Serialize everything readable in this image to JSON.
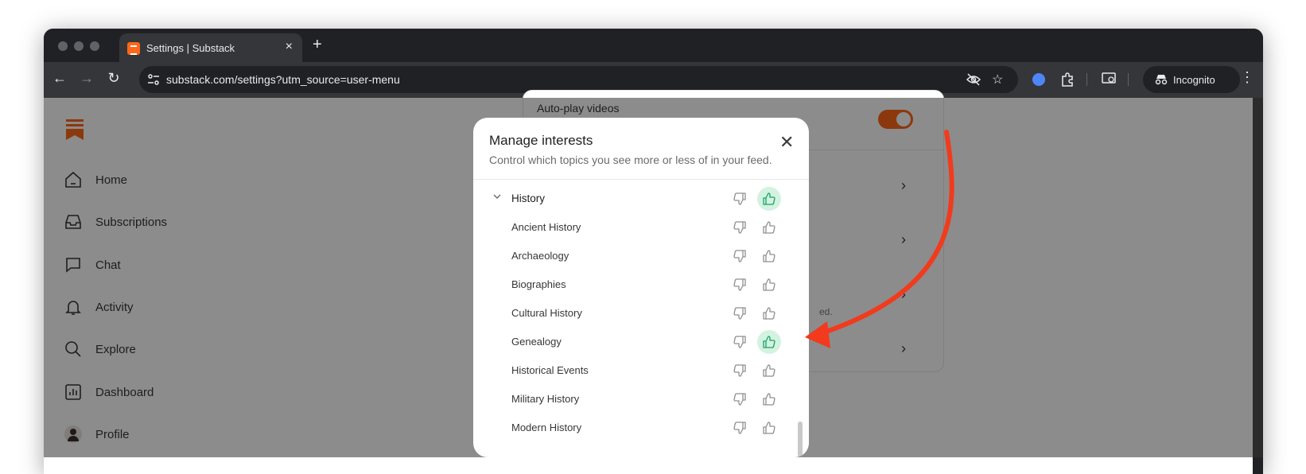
{
  "browser": {
    "tab_title": "Settings | Substack",
    "url_host": "substack.com",
    "url_path": "/settings?utm_source=user-menu",
    "incognito_label": "Incognito",
    "tab_close": "×",
    "new_tab": "+"
  },
  "sidebar": {
    "items": [
      {
        "label": "Home",
        "icon": "home-icon"
      },
      {
        "label": "Subscriptions",
        "icon": "inbox-icon"
      },
      {
        "label": "Chat",
        "icon": "chat-icon"
      },
      {
        "label": "Activity",
        "icon": "bell-icon"
      },
      {
        "label": "Explore",
        "icon": "search-icon"
      },
      {
        "label": "Dashboard",
        "icon": "dashboard-icon"
      },
      {
        "label": "Profile",
        "icon": "avatar"
      }
    ]
  },
  "settings": {
    "autoplay_label": "Auto-play videos",
    "feed_fragment": "ed."
  },
  "modal": {
    "title": "Manage interests",
    "subtitle": "Control which topics you see more or less of in your feed.",
    "close": "✕",
    "category": {
      "label": "History",
      "liked": true
    },
    "topics": [
      {
        "label": "Ancient History",
        "liked": false
      },
      {
        "label": "Archaeology",
        "liked": false
      },
      {
        "label": "Biographies",
        "liked": false
      },
      {
        "label": "Cultural History",
        "liked": false
      },
      {
        "label": "Genealogy",
        "liked": true
      },
      {
        "label": "Historical Events",
        "liked": false
      },
      {
        "label": "Military History",
        "liked": false
      },
      {
        "label": "Modern History",
        "liked": false
      }
    ]
  },
  "colors": {
    "brand": "#ff6719",
    "like_active_bg": "#d4f2e1",
    "like_active": "#1aa364",
    "annotation_arrow": "#f23a1d"
  }
}
